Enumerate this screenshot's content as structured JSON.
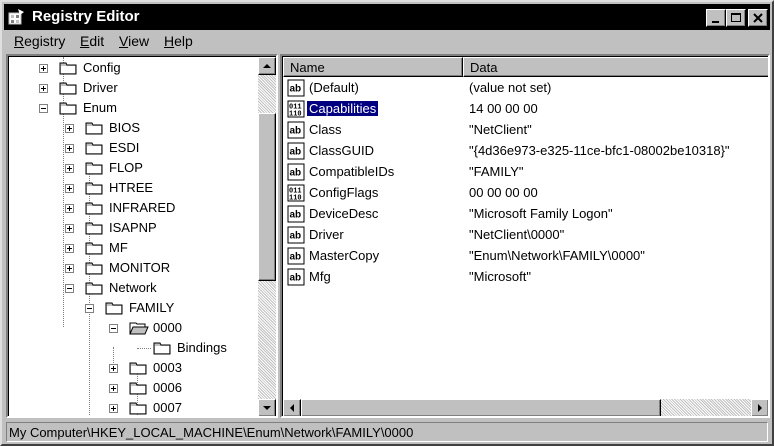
{
  "window": {
    "title": "Registry Editor"
  },
  "menu": {
    "items": [
      {
        "label": "Registry"
      },
      {
        "label": "Edit"
      },
      {
        "label": "View"
      },
      {
        "label": "Help"
      }
    ]
  },
  "tree": {
    "nodes": [
      {
        "label": "Config",
        "level": 2,
        "expander": "plus",
        "open": false
      },
      {
        "label": "Driver",
        "level": 2,
        "expander": "plus",
        "open": false
      },
      {
        "label": "Enum",
        "level": 2,
        "expander": "minus",
        "open": false
      },
      {
        "label": "BIOS",
        "level": 3,
        "expander": "plus",
        "open": false
      },
      {
        "label": "ESDI",
        "level": 3,
        "expander": "plus",
        "open": false
      },
      {
        "label": "FLOP",
        "level": 3,
        "expander": "plus",
        "open": false
      },
      {
        "label": "HTREE",
        "level": 3,
        "expander": "plus",
        "open": false
      },
      {
        "label": "INFRARED",
        "level": 3,
        "expander": "plus",
        "open": false
      },
      {
        "label": "ISAPNP",
        "level": 3,
        "expander": "plus",
        "open": false
      },
      {
        "label": "MF",
        "level": 3,
        "expander": "plus",
        "open": false
      },
      {
        "label": "MONITOR",
        "level": 3,
        "expander": "plus",
        "open": false
      },
      {
        "label": "Network",
        "level": 3,
        "expander": "minus",
        "open": false
      },
      {
        "label": "FAMILY",
        "level": 4,
        "expander": "minus",
        "open": false
      },
      {
        "label": "0000",
        "level": 5,
        "expander": "minus",
        "open": true
      },
      {
        "label": "Bindings",
        "level": 6,
        "expander": "none",
        "open": false
      },
      {
        "label": "0003",
        "level": 5,
        "expander": "plus",
        "open": false
      },
      {
        "label": "0006",
        "level": 5,
        "expander": "plus",
        "open": false
      },
      {
        "label": "0007",
        "level": 5,
        "expander": "plus",
        "open": false
      }
    ]
  },
  "values": {
    "columns": {
      "name": "Name",
      "data": "Data"
    },
    "rows": [
      {
        "name": "(Default)",
        "data": "(value not set)",
        "type": "string-icon"
      },
      {
        "name": "Capabilities",
        "data": "14 00 00 00",
        "type": "binary-icon",
        "selected": true
      },
      {
        "name": "Class",
        "data": "\"NetClient\"",
        "type": "string-icon"
      },
      {
        "name": "ClassGUID",
        "data": "\"{4d36e973-e325-11ce-bfc1-08002be10318}\"",
        "type": "string-icon"
      },
      {
        "name": "CompatibleIDs",
        "data": "\"FAMILY\"",
        "type": "string-icon"
      },
      {
        "name": "ConfigFlags",
        "data": "00 00 00 00",
        "type": "binary-icon"
      },
      {
        "name": "DeviceDesc",
        "data": "\"Microsoft Family Logon\"",
        "type": "string-icon"
      },
      {
        "name": "Driver",
        "data": "\"NetClient\\0000\"",
        "type": "string-icon"
      },
      {
        "name": "MasterCopy",
        "data": "\"Enum\\Network\\FAMILY\\0000\"",
        "type": "string-icon"
      },
      {
        "name": "Mfg",
        "data": "\"Microsoft\"",
        "type": "string-icon"
      }
    ]
  },
  "status": {
    "path": "My Computer\\HKEY_LOCAL_MACHINE\\Enum\\Network\\FAMILY\\0000"
  }
}
